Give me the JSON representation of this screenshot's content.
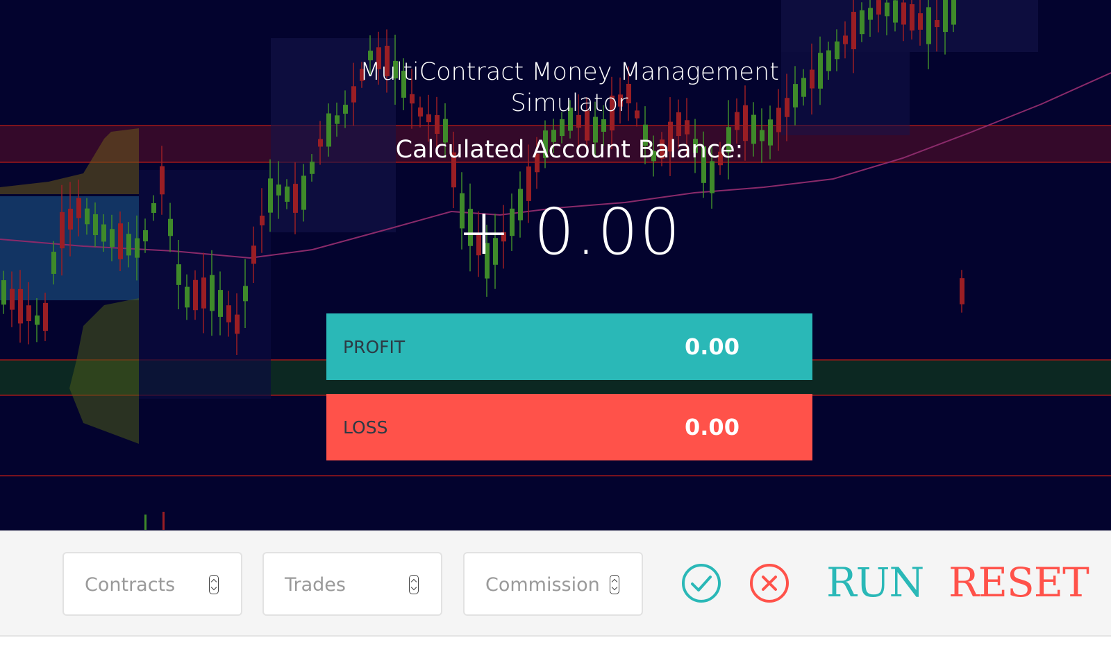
{
  "app": {
    "title_line1": "MultiContract Money Management",
    "title_line2": "Simulator",
    "balance_label": "Calculated Account Balance:",
    "balance_value": "+ 0.00"
  },
  "stats": {
    "profit": {
      "label": "PROFIT",
      "value": "0.00"
    },
    "loss": {
      "label": "LOSS",
      "value": "0.00"
    }
  },
  "inputs": {
    "contracts": {
      "placeholder": "Contracts"
    },
    "trades": {
      "placeholder": "Trades"
    },
    "commission": {
      "placeholder": "Commission"
    }
  },
  "actions": {
    "confirm_icon": "check-circle-icon",
    "cancel_icon": "x-circle-icon",
    "run_label": "RUN",
    "reset_label": "RESET"
  },
  "colors": {
    "background": "#03032e",
    "accent_teal": "#2ab8b7",
    "accent_red": "#ff524a",
    "toolbar": "#f5f5f5"
  }
}
